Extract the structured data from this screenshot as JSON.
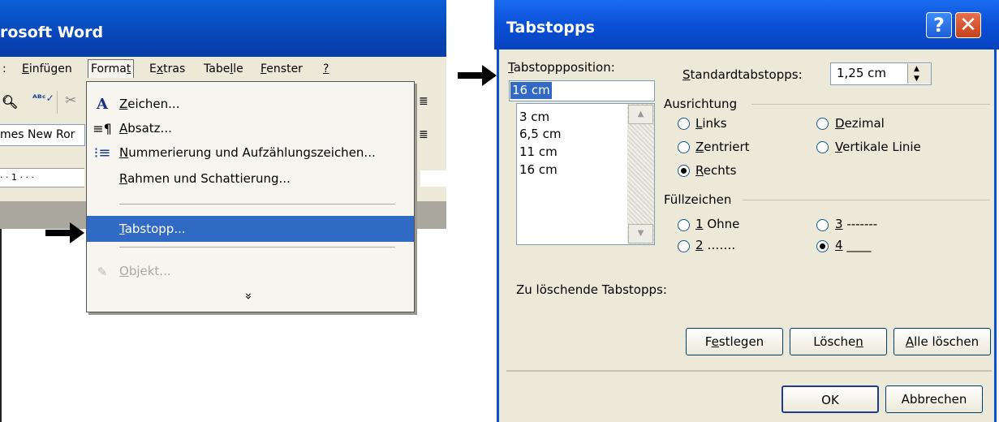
{
  "word": {
    "title": "rosoft Word",
    "menu": [
      {
        "label": ": ",
        "u": ""
      },
      {
        "label": "Einfügen",
        "u": "E"
      },
      {
        "label": "Format",
        "u": "t"
      },
      {
        "label": "Extras",
        "u": "x"
      },
      {
        "label": "Tabelle",
        "u": "l"
      },
      {
        "label": "Fenster",
        "u": "F"
      },
      {
        "label": "?",
        "u": "?"
      }
    ],
    "font_name": "mes New Ror",
    "ruler_text": "· · 1 · · ·"
  },
  "dropdown": {
    "items": {
      "zeichen": {
        "pre": "",
        "u": "Z",
        "post": "eichen..."
      },
      "absatz": {
        "pre": "",
        "u": "A",
        "post": "bsatz..."
      },
      "nummerierung": {
        "pre": "",
        "u": "N",
        "post": "ummerierung und Aufzählungszeichen..."
      },
      "rahmen": {
        "pre": "",
        "u": "R",
        "post": "ahmen und Schattierung..."
      },
      "tabstopp": {
        "pre": "",
        "u": "T",
        "post": "abstopp..."
      },
      "objekt": {
        "pre": "",
        "u": "O",
        "post": "bjekt..."
      }
    },
    "expand": "»"
  },
  "dialog": {
    "title": "Tabstopps",
    "help": "?",
    "close": "✕",
    "tabpos_label": {
      "pre": "",
      "u": "T",
      "post": "abstoppposition:"
    },
    "tabpos_value": "16 cm",
    "tab_list": [
      "3 cm",
      "6,5 cm",
      "11 cm",
      "16 cm"
    ],
    "std_label": {
      "pre": "",
      "u": "S",
      "post": "tandardtabstopps:"
    },
    "std_value": "1,25 cm",
    "ausrichtung": {
      "title": "Ausrichtung",
      "options": {
        "links": {
          "pre": "",
          "u": "L",
          "post": "inks"
        },
        "zentriert": {
          "pre": "",
          "u": "Z",
          "post": "entriert"
        },
        "rechts": {
          "pre": "",
          "u": "R",
          "post": "echts"
        },
        "dezimal": {
          "pre": "",
          "u": "D",
          "post": "ezimal"
        },
        "vertikale": {
          "pre": "",
          "u": "V",
          "post": "ertikale Linie"
        }
      },
      "selected": "rechts"
    },
    "fuellzeichen": {
      "title": "Füllzeichen",
      "options": {
        "o1": {
          "pre": "",
          "u": "1",
          "post": " Ohne"
        },
        "o2": {
          "pre": "",
          "u": "2",
          "post": " ……."
        },
        "o3": {
          "pre": "",
          "u": "3",
          "post": " -------"
        },
        "o4": {
          "pre": "",
          "u": "4",
          "post": " ____"
        }
      },
      "selected": "o4"
    },
    "delete_label": "Zu löschende Tabstopps:",
    "buttons": {
      "festlegen": {
        "pre": "F",
        "u": "e",
        "post": "stlegen"
      },
      "loeschen": {
        "pre": "Lösche",
        "u": "n",
        "post": ""
      },
      "alle": {
        "pre": "",
        "u": "A",
        "post": "lle löschen"
      },
      "ok": {
        "pre": "OK",
        "u": "",
        "post": ""
      },
      "abbrechen": {
        "pre": "Abbrechen",
        "u": "",
        "post": ""
      }
    }
  }
}
